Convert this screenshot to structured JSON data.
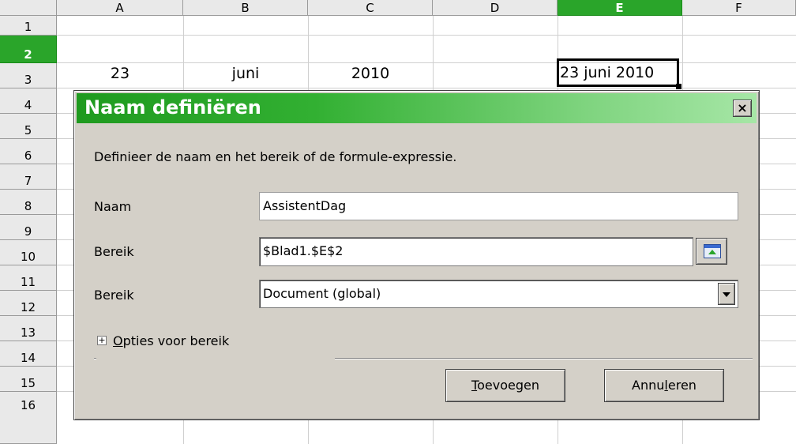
{
  "sheet": {
    "columns": [
      "A",
      "B",
      "C",
      "D",
      "E",
      "F"
    ],
    "active_column": "E",
    "rows": [
      "1",
      "2",
      "3",
      "4",
      "5",
      "6",
      "7",
      "8",
      "9",
      "10",
      "11",
      "12",
      "13",
      "14",
      "15",
      "16"
    ],
    "active_row": "2",
    "cells": {
      "A2": "23",
      "B2": "juni",
      "C2": "2010",
      "E2": "23 juni 2010"
    }
  },
  "dialog": {
    "title": "Naam definiëren",
    "close_glyph": "×",
    "description": "Definieer de naam en het bereik of de formule-expressie.",
    "name_label": "Naam",
    "name_value": "AssistentDag",
    "range_label": "Bereik",
    "range_value": "$Blad1.$E$2",
    "scope_label": "Bereik",
    "scope_value": "Document (global)",
    "options_expander_glyph": "+",
    "options_label_underlined": "O",
    "options_label_rest": "pties voor bereik",
    "add_button_underlined": "T",
    "add_button_rest": "oevoegen",
    "cancel_button_before": "Annu",
    "cancel_button_underlined": "l",
    "cancel_button_after": "eren"
  },
  "icons": [
    "close-icon",
    "shrink-dialog-icon",
    "dropdown-arrow-icon",
    "expand-plus-icon"
  ],
  "colors": {
    "active_header": "#2aa52a",
    "dialog_bg": "#d4d0c8",
    "title_gradient_start": "#1f9a1f",
    "title_gradient_end": "#a6e6a6"
  }
}
